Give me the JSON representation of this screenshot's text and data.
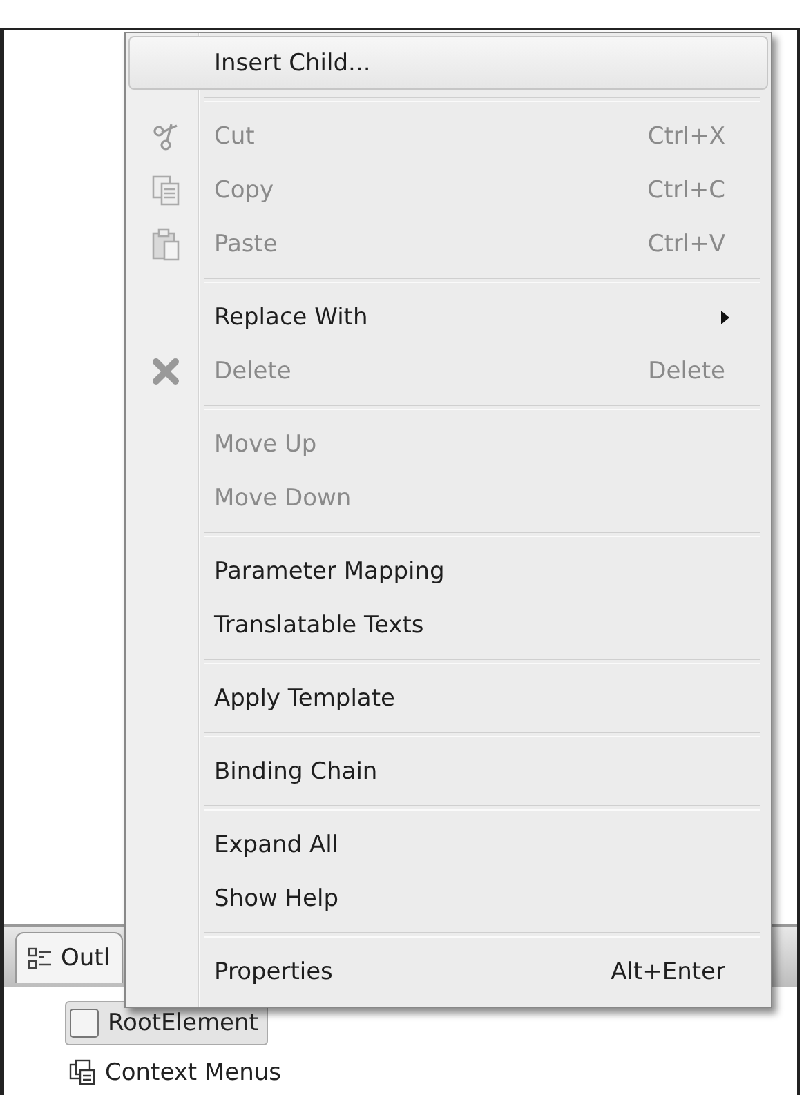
{
  "outline_panel": {
    "tab": {
      "label": "Outl",
      "selected": true
    },
    "tree": [
      {
        "label": "RootElement",
        "selected": true,
        "kind": "element"
      },
      {
        "label": "Context Menus",
        "selected": false,
        "kind": "menus"
      }
    ]
  },
  "context_menu": {
    "groups": [
      [
        {
          "label": "Insert Child...",
          "selected": true,
          "disabled": false,
          "kind": "plain"
        }
      ],
      [
        {
          "label": "Cut",
          "shortcut": "Ctrl+X",
          "selected": false,
          "disabled": true,
          "kind": "scissors"
        },
        {
          "label": "Copy",
          "shortcut": "Ctrl+C",
          "selected": false,
          "disabled": true,
          "kind": "copy"
        },
        {
          "label": "Paste",
          "shortcut": "Ctrl+V",
          "selected": false,
          "disabled": true,
          "kind": "paste"
        }
      ],
      [
        {
          "label": "Replace With",
          "selected": false,
          "disabled": false,
          "kind": "submenu"
        },
        {
          "label": "Delete",
          "shortcut": "Delete",
          "selected": false,
          "disabled": true,
          "kind": "delete"
        }
      ],
      [
        {
          "label": "Move Up",
          "selected": false,
          "disabled": true,
          "kind": "plain"
        },
        {
          "label": "Move Down",
          "selected": false,
          "disabled": true,
          "kind": "plain"
        }
      ],
      [
        {
          "label": "Parameter Mapping",
          "selected": false,
          "disabled": false,
          "kind": "plain"
        },
        {
          "label": "Translatable Texts",
          "selected": false,
          "disabled": false,
          "kind": "plain"
        }
      ],
      [
        {
          "label": "Apply Template",
          "selected": false,
          "disabled": false,
          "kind": "plain"
        }
      ],
      [
        {
          "label": "Binding Chain",
          "selected": false,
          "disabled": false,
          "kind": "plain"
        }
      ],
      [
        {
          "label": "Expand All",
          "selected": false,
          "disabled": false,
          "kind": "plain"
        },
        {
          "label": "Show Help",
          "selected": false,
          "disabled": false,
          "kind": "plain"
        }
      ],
      [
        {
          "label": "Properties",
          "shortcut": "Alt+Enter",
          "selected": false,
          "disabled": false,
          "kind": "plain"
        }
      ]
    ]
  }
}
